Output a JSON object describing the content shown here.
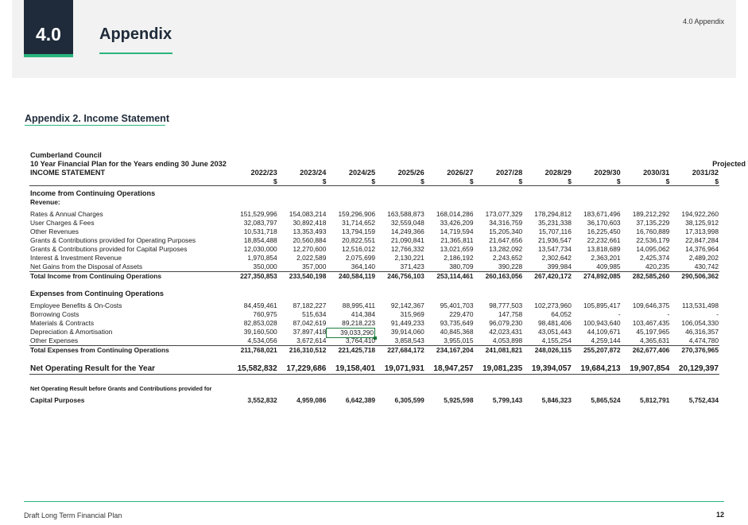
{
  "header": {
    "section_number": "4.0",
    "title": "Appendix",
    "top_right": "4.0 Appendix"
  },
  "sub_heading": "Appendix 2. Income Statement",
  "statement": {
    "council": "Cumberland Council",
    "plan_title": "10 Year Financial Plan for the Years ending 30 June 2032",
    "statement_name": "INCOME STATEMENT",
    "projected_label": "Projected Years",
    "years": [
      "2022/23",
      "2023/24",
      "2024/25",
      "2025/26",
      "2026/27",
      "2027/28",
      "2028/29",
      "2029/30",
      "2030/31",
      "2031/32"
    ],
    "currency": [
      "$",
      "$",
      "$",
      "$",
      "$",
      "$",
      "$",
      "$",
      "$",
      "$"
    ],
    "income_heading": "Income from Continuing Operations",
    "revenue_label": "Revenue:",
    "income_rows": [
      {
        "label": "Rates & Annual Charges",
        "values": [
          "151,529,996",
          "154,083,214",
          "159,296,906",
          "163,588,873",
          "168,014,286",
          "173,077,329",
          "178,294,812",
          "183,671,496",
          "189,212,292",
          "194,922,260"
        ]
      },
      {
        "label": "User Charges & Fees",
        "values": [
          "32,083,797",
          "30,892,418",
          "31,714,652",
          "32,559,048",
          "33,426,209",
          "34,316,759",
          "35,231,338",
          "36,170,603",
          "37,135,229",
          "38,125,912"
        ]
      },
      {
        "label": "Other Revenues",
        "values": [
          "10,531,718",
          "13,353,493",
          "13,794,159",
          "14,249,366",
          "14,719,594",
          "15,205,340",
          "15,707,116",
          "16,225,450",
          "16,760,889",
          "17,313,998"
        ]
      },
      {
        "label": "Grants & Contributions provided for Operating Purposes",
        "values": [
          "18,854,488",
          "20,560,884",
          "20,822,551",
          "21,090,841",
          "21,365,811",
          "21,647,656",
          "21,936,547",
          "22,232,661",
          "22,536,179",
          "22,847,284"
        ]
      },
      {
        "label": "Grants & Contributions provided for Capital Purposes",
        "values": [
          "12,030,000",
          "12,270,600",
          "12,516,012",
          "12,766,332",
          "13,021,659",
          "13,282,092",
          "13,547,734",
          "13,818,689",
          "14,095,062",
          "14,376,964"
        ]
      },
      {
        "label": "Interest & Investment Revenue",
        "values": [
          "1,970,854",
          "2,022,589",
          "2,075,699",
          "2,130,221",
          "2,186,192",
          "2,243,652",
          "2,302,642",
          "2,363,201",
          "2,425,374",
          "2,489,202"
        ]
      },
      {
        "label": "Net Gains from the Disposal of Assets",
        "values": [
          "350,000",
          "357,000",
          "364,140",
          "371,423",
          "380,709",
          "390,228",
          "399,984",
          "409,985",
          "420,235",
          "430,742"
        ]
      }
    ],
    "total_income": {
      "label": "Total Income from Continuing Operations",
      "values": [
        "227,350,853",
        "233,540,198",
        "240,584,119",
        "246,756,103",
        "253,114,461",
        "260,163,056",
        "267,420,172",
        "274,892,085",
        "282,585,260",
        "290,506,362"
      ]
    },
    "expenses_heading": "Expenses from Continuing Operations",
    "expense_rows": [
      {
        "label": "Employee Benefits & On-Costs",
        "values": [
          "84,459,461",
          "87,182,227",
          "88,995,411",
          "92,142,367",
          "95,401,703",
          "98,777,503",
          "102,273,960",
          "105,895,417",
          "109,646,375",
          "113,531,498"
        ]
      },
      {
        "label": "Borrowing Costs",
        "values": [
          "760,975",
          "515,634",
          "414,384",
          "315,969",
          "229,470",
          "147,758",
          "64,052",
          "-",
          "-",
          "-"
        ]
      },
      {
        "label": "Materials & Contracts",
        "values": [
          "82,853,028",
          "87,042,619",
          "89,218,223",
          "91,449,233",
          "93,735,649",
          "96,079,230",
          "98,481,406",
          "100,943,640",
          "103,467,435",
          "106,054,330"
        ]
      },
      {
        "label": "Depreciation & Amortisation",
        "values": [
          "39,160,500",
          "37,897,418",
          "39,033,290",
          "39,914,060",
          "40,845,368",
          "42,023,431",
          "43,051,443",
          "44,109,671",
          "45,197,965",
          "46,316,357"
        ]
      },
      {
        "label": "Other Expenses",
        "values": [
          "4,534,056",
          "3,672,614",
          "3,764,410",
          "3,858,543",
          "3,955,015",
          "4,053,898",
          "4,155,254",
          "4,259,144",
          "4,365,631",
          "4,474,780"
        ]
      }
    ],
    "total_expenses": {
      "label": "Total Expenses from Continuing Operations",
      "values": [
        "211,768,021",
        "216,310,512",
        "221,425,718",
        "227,684,172",
        "234,167,204",
        "241,081,821",
        "248,026,115",
        "255,207,872",
        "262,677,406",
        "270,376,965"
      ]
    },
    "net_result": {
      "label": "Net Operating Result for the Year",
      "values": [
        "15,582,832",
        "17,229,686",
        "19,158,401",
        "19,071,931",
        "18,947,257",
        "19,081,235",
        "19,394,057",
        "19,684,213",
        "19,907,854",
        "20,129,397"
      ]
    },
    "net_before_grants": {
      "label_line1": "Net Operating Result before Grants and Contributions provided for",
      "label_line2": "Capital Purposes",
      "values": [
        "3,552,832",
        "4,959,086",
        "6,642,389",
        "6,305,599",
        "5,925,598",
        "5,799,143",
        "5,846,323",
        "5,865,524",
        "5,812,791",
        "5,752,434"
      ]
    }
  },
  "footer": {
    "left": "Draft Long Term Financial Plan",
    "page": "12"
  },
  "colors": {
    "navy": "#1f2b3a",
    "accent_green": "#2ab57d"
  }
}
